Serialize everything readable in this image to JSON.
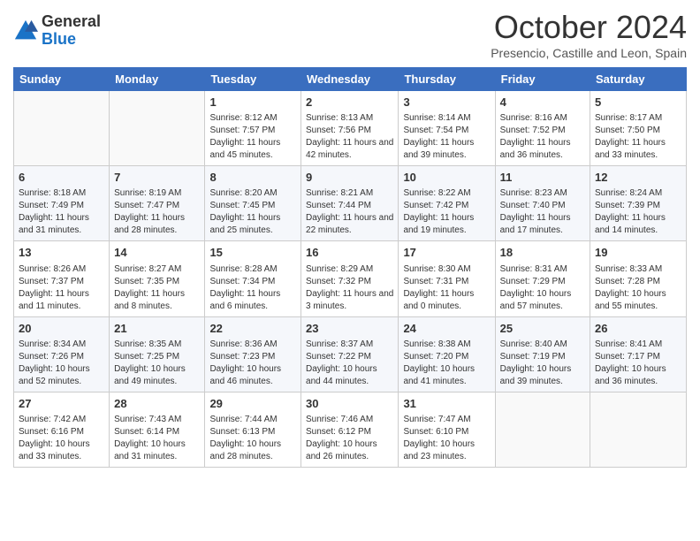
{
  "logo": {
    "general": "General",
    "blue": "Blue"
  },
  "title": "October 2024",
  "subtitle": "Presencio, Castille and Leon, Spain",
  "days_of_week": [
    "Sunday",
    "Monday",
    "Tuesday",
    "Wednesday",
    "Thursday",
    "Friday",
    "Saturday"
  ],
  "weeks": [
    [
      {
        "day": "",
        "info": ""
      },
      {
        "day": "",
        "info": ""
      },
      {
        "day": "1",
        "info": "Sunrise: 8:12 AM\nSunset: 7:57 PM\nDaylight: 11 hours and 45 minutes."
      },
      {
        "day": "2",
        "info": "Sunrise: 8:13 AM\nSunset: 7:56 PM\nDaylight: 11 hours and 42 minutes."
      },
      {
        "day": "3",
        "info": "Sunrise: 8:14 AM\nSunset: 7:54 PM\nDaylight: 11 hours and 39 minutes."
      },
      {
        "day": "4",
        "info": "Sunrise: 8:16 AM\nSunset: 7:52 PM\nDaylight: 11 hours and 36 minutes."
      },
      {
        "day": "5",
        "info": "Sunrise: 8:17 AM\nSunset: 7:50 PM\nDaylight: 11 hours and 33 minutes."
      }
    ],
    [
      {
        "day": "6",
        "info": "Sunrise: 8:18 AM\nSunset: 7:49 PM\nDaylight: 11 hours and 31 minutes."
      },
      {
        "day": "7",
        "info": "Sunrise: 8:19 AM\nSunset: 7:47 PM\nDaylight: 11 hours and 28 minutes."
      },
      {
        "day": "8",
        "info": "Sunrise: 8:20 AM\nSunset: 7:45 PM\nDaylight: 11 hours and 25 minutes."
      },
      {
        "day": "9",
        "info": "Sunrise: 8:21 AM\nSunset: 7:44 PM\nDaylight: 11 hours and 22 minutes."
      },
      {
        "day": "10",
        "info": "Sunrise: 8:22 AM\nSunset: 7:42 PM\nDaylight: 11 hours and 19 minutes."
      },
      {
        "day": "11",
        "info": "Sunrise: 8:23 AM\nSunset: 7:40 PM\nDaylight: 11 hours and 17 minutes."
      },
      {
        "day": "12",
        "info": "Sunrise: 8:24 AM\nSunset: 7:39 PM\nDaylight: 11 hours and 14 minutes."
      }
    ],
    [
      {
        "day": "13",
        "info": "Sunrise: 8:26 AM\nSunset: 7:37 PM\nDaylight: 11 hours and 11 minutes."
      },
      {
        "day": "14",
        "info": "Sunrise: 8:27 AM\nSunset: 7:35 PM\nDaylight: 11 hours and 8 minutes."
      },
      {
        "day": "15",
        "info": "Sunrise: 8:28 AM\nSunset: 7:34 PM\nDaylight: 11 hours and 6 minutes."
      },
      {
        "day": "16",
        "info": "Sunrise: 8:29 AM\nSunset: 7:32 PM\nDaylight: 11 hours and 3 minutes."
      },
      {
        "day": "17",
        "info": "Sunrise: 8:30 AM\nSunset: 7:31 PM\nDaylight: 11 hours and 0 minutes."
      },
      {
        "day": "18",
        "info": "Sunrise: 8:31 AM\nSunset: 7:29 PM\nDaylight: 10 hours and 57 minutes."
      },
      {
        "day": "19",
        "info": "Sunrise: 8:33 AM\nSunset: 7:28 PM\nDaylight: 10 hours and 55 minutes."
      }
    ],
    [
      {
        "day": "20",
        "info": "Sunrise: 8:34 AM\nSunset: 7:26 PM\nDaylight: 10 hours and 52 minutes."
      },
      {
        "day": "21",
        "info": "Sunrise: 8:35 AM\nSunset: 7:25 PM\nDaylight: 10 hours and 49 minutes."
      },
      {
        "day": "22",
        "info": "Sunrise: 8:36 AM\nSunset: 7:23 PM\nDaylight: 10 hours and 46 minutes."
      },
      {
        "day": "23",
        "info": "Sunrise: 8:37 AM\nSunset: 7:22 PM\nDaylight: 10 hours and 44 minutes."
      },
      {
        "day": "24",
        "info": "Sunrise: 8:38 AM\nSunset: 7:20 PM\nDaylight: 10 hours and 41 minutes."
      },
      {
        "day": "25",
        "info": "Sunrise: 8:40 AM\nSunset: 7:19 PM\nDaylight: 10 hours and 39 minutes."
      },
      {
        "day": "26",
        "info": "Sunrise: 8:41 AM\nSunset: 7:17 PM\nDaylight: 10 hours and 36 minutes."
      }
    ],
    [
      {
        "day": "27",
        "info": "Sunrise: 7:42 AM\nSunset: 6:16 PM\nDaylight: 10 hours and 33 minutes."
      },
      {
        "day": "28",
        "info": "Sunrise: 7:43 AM\nSunset: 6:14 PM\nDaylight: 10 hours and 31 minutes."
      },
      {
        "day": "29",
        "info": "Sunrise: 7:44 AM\nSunset: 6:13 PM\nDaylight: 10 hours and 28 minutes."
      },
      {
        "day": "30",
        "info": "Sunrise: 7:46 AM\nSunset: 6:12 PM\nDaylight: 10 hours and 26 minutes."
      },
      {
        "day": "31",
        "info": "Sunrise: 7:47 AM\nSunset: 6:10 PM\nDaylight: 10 hours and 23 minutes."
      },
      {
        "day": "",
        "info": ""
      },
      {
        "day": "",
        "info": ""
      }
    ]
  ]
}
